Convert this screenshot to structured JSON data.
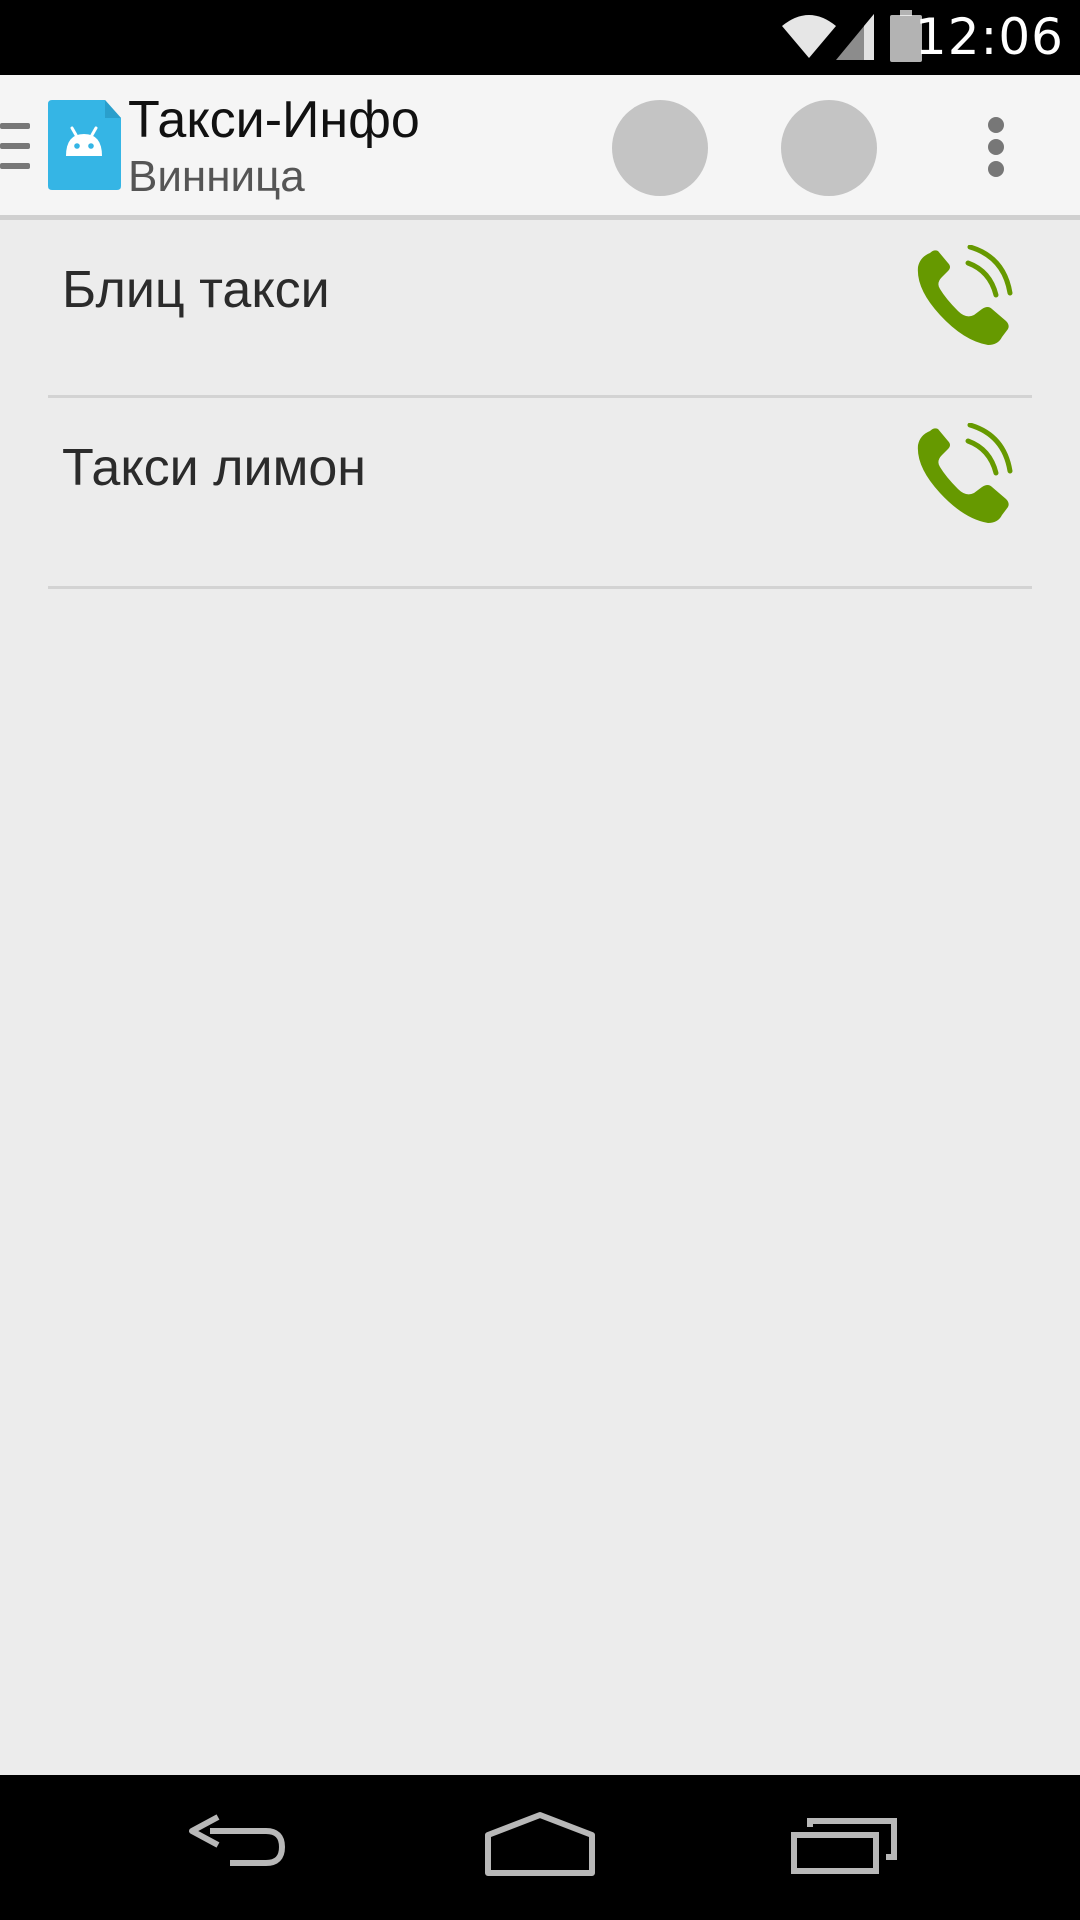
{
  "status_bar": {
    "time": "12:06",
    "icons": [
      "wifi-icon",
      "signal-icon",
      "battery-icon"
    ]
  },
  "action_bar": {
    "title": "Такси-Инфо",
    "subtitle": "Винница",
    "app_icon": "android-app-icon",
    "accent_color": "#35b5e5",
    "actions": [
      "action-circle",
      "action-circle"
    ],
    "overflow_icon": "overflow-menu-icon"
  },
  "list": {
    "items": [
      {
        "label": "Блиц такси",
        "icon": "phone-call-icon"
      },
      {
        "label": "Такси лимон",
        "icon": "phone-call-icon"
      }
    ],
    "call_icon_color": "#669900"
  },
  "nav_bar": {
    "buttons": [
      "back-icon",
      "home-icon",
      "recents-icon"
    ]
  }
}
